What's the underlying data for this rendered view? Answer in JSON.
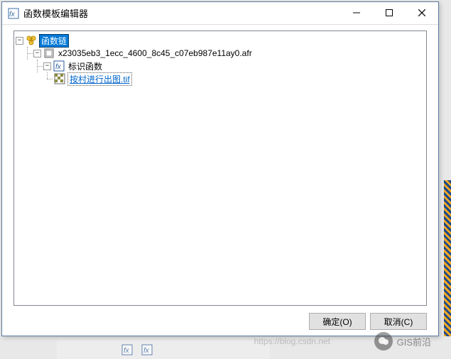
{
  "window": {
    "title": "函数模板编辑器"
  },
  "tree": {
    "root": {
      "label": "函数链"
    },
    "file": {
      "label": "x23035eb3_1ecc_4600_8c45_c07eb987e11ay0.afr"
    },
    "func": {
      "label": "标识函数"
    },
    "raster": {
      "label": "按村进行出图.tif"
    }
  },
  "buttons": {
    "ok": "确定(O)",
    "cancel": "取消(C)"
  },
  "watermark": {
    "text": "GIS前沿",
    "url": "https://blog.csdn.net"
  }
}
